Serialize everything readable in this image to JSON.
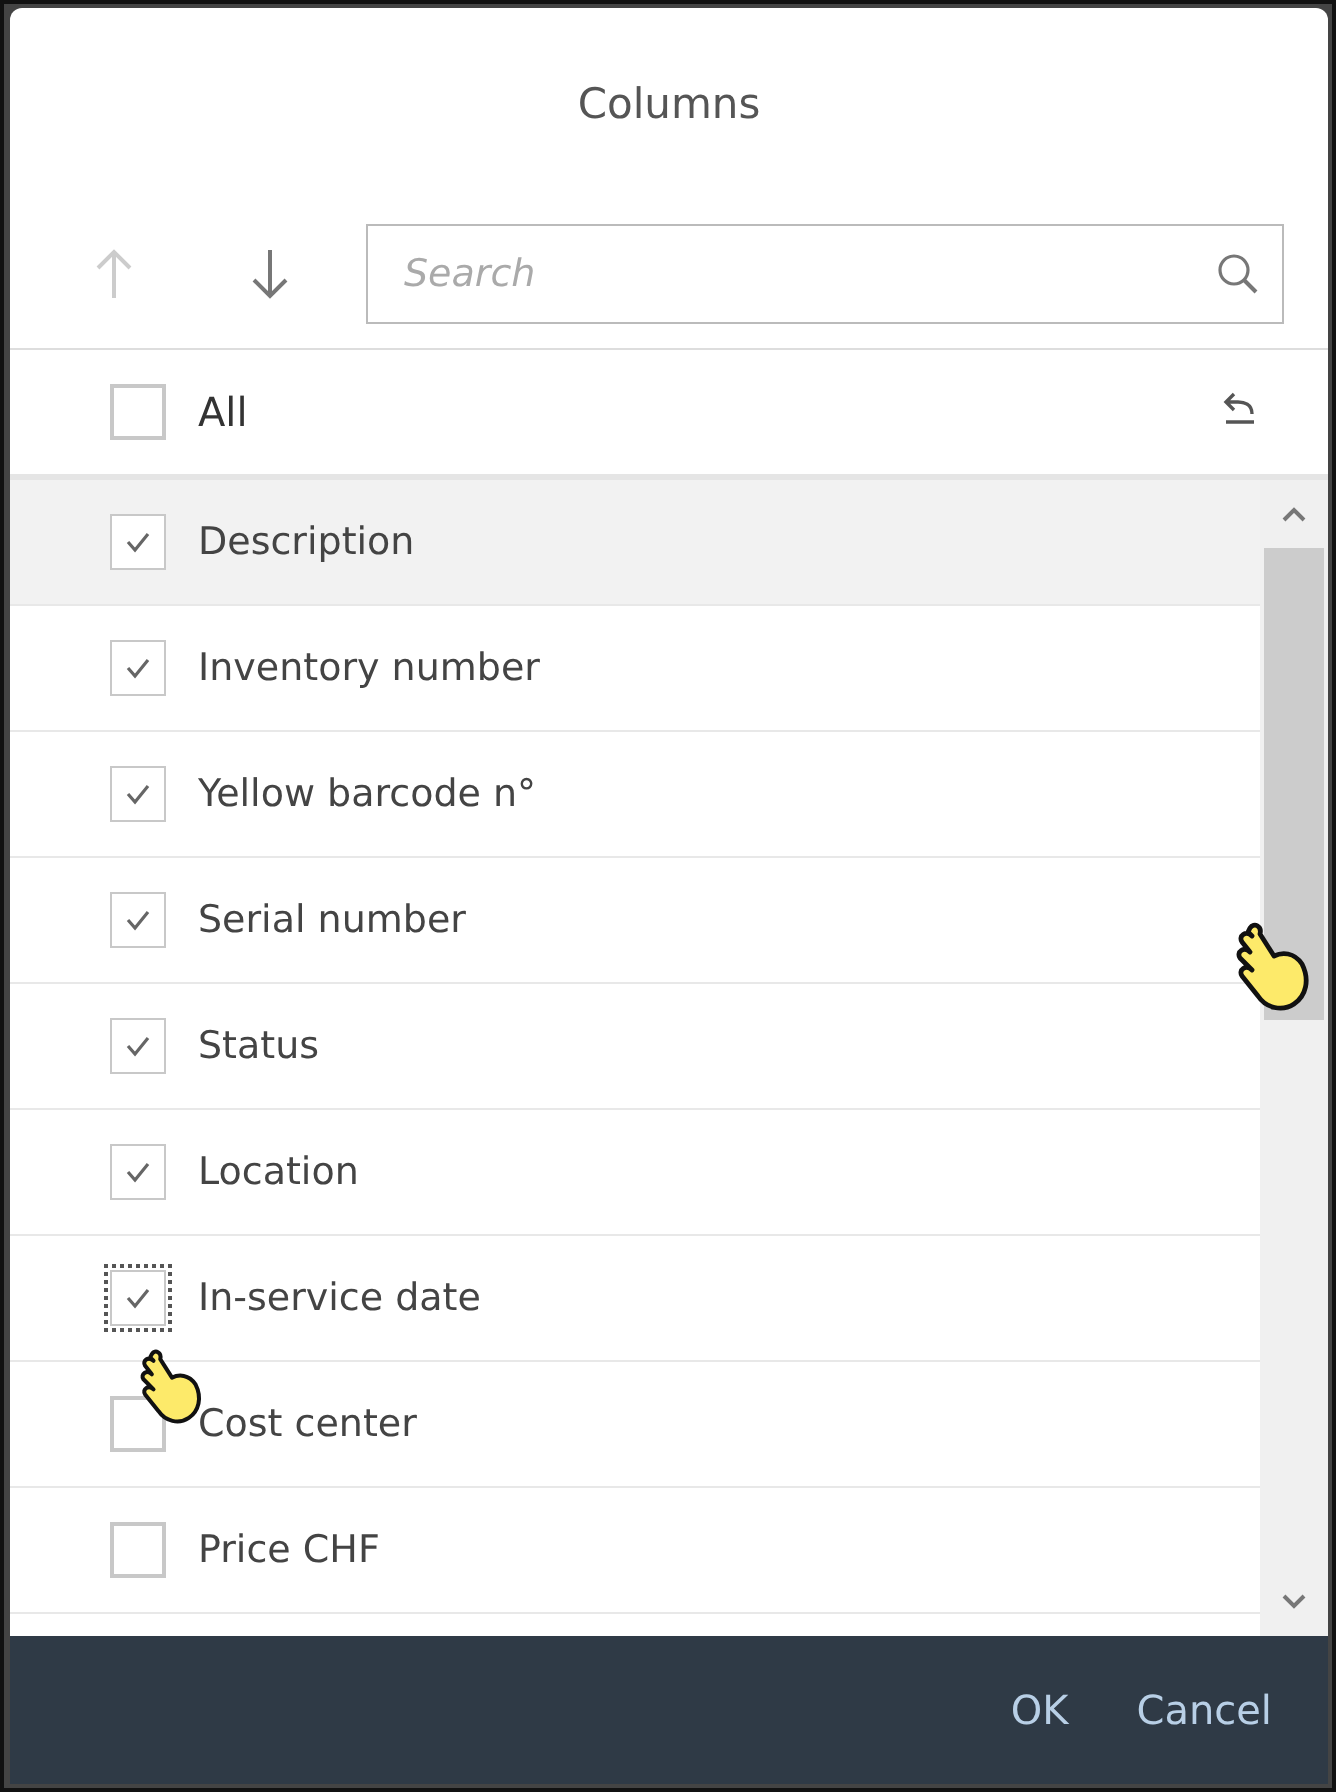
{
  "dialog": {
    "title": "Columns"
  },
  "toolbar": {
    "move_up": {
      "disabled": true
    },
    "move_down": {
      "disabled": false
    },
    "search": {
      "placeholder": "Search"
    }
  },
  "select_all": {
    "label": "All",
    "checked": false
  },
  "columns": [
    {
      "label": "Description",
      "checked": true,
      "highlighted": true,
      "focused": false
    },
    {
      "label": "Inventory number",
      "checked": true,
      "highlighted": false,
      "focused": false
    },
    {
      "label": "Yellow barcode n°",
      "checked": true,
      "highlighted": false,
      "focused": false
    },
    {
      "label": "Serial number",
      "checked": true,
      "highlighted": false,
      "focused": false
    },
    {
      "label": "Status",
      "checked": true,
      "highlighted": false,
      "focused": false
    },
    {
      "label": "Location",
      "checked": true,
      "highlighted": false,
      "focused": false
    },
    {
      "label": "In-service date",
      "checked": true,
      "highlighted": false,
      "focused": true
    },
    {
      "label": "Cost center",
      "checked": false,
      "highlighted": false,
      "focused": false
    },
    {
      "label": "Price CHF",
      "checked": false,
      "highlighted": false,
      "focused": false
    }
  ],
  "buttons": [
    {
      "label": "OK"
    },
    {
      "label": "Cancel"
    }
  ]
}
